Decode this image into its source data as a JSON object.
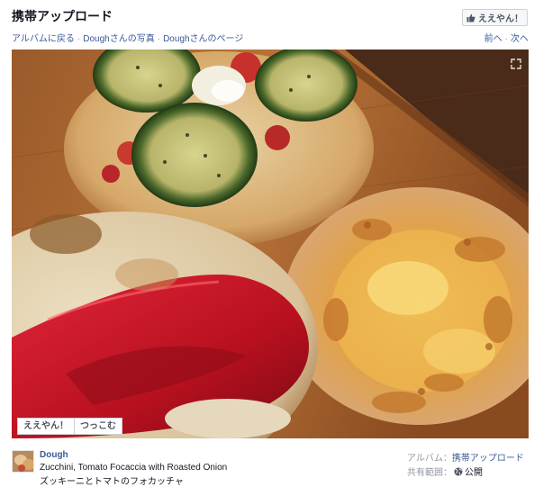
{
  "header": {
    "album_title": "携帯アップロード",
    "like_button": "ええやん！"
  },
  "breadcrumb": {
    "back_to_album": "アルバムに戻る",
    "owner_photos": "Doughさんの写真",
    "owner_page": "Doughさんのページ",
    "separator": "·"
  },
  "pager": {
    "prev": "前へ",
    "next": "次へ",
    "separator": "·"
  },
  "photo": {
    "actions": {
      "like": "ええやん！",
      "comment": "つっこむ"
    }
  },
  "footer": {
    "owner_name": "Dough",
    "caption_en": "Zucchini, Tomato Focaccia with Roasted Onion",
    "caption_ja": "ズッキーニとトマトのフォカッチャ",
    "album_label": "アルバム：",
    "album_name": "携帯アップロード",
    "privacy_label": "共有範囲：",
    "privacy_value": "公開"
  },
  "colors": {
    "link": "#3b5998",
    "muted": "#9197a3",
    "text": "#141823"
  },
  "icons": {
    "like": "thumbs-up-icon",
    "expand": "expand-icon",
    "privacy": "globe-icon"
  }
}
